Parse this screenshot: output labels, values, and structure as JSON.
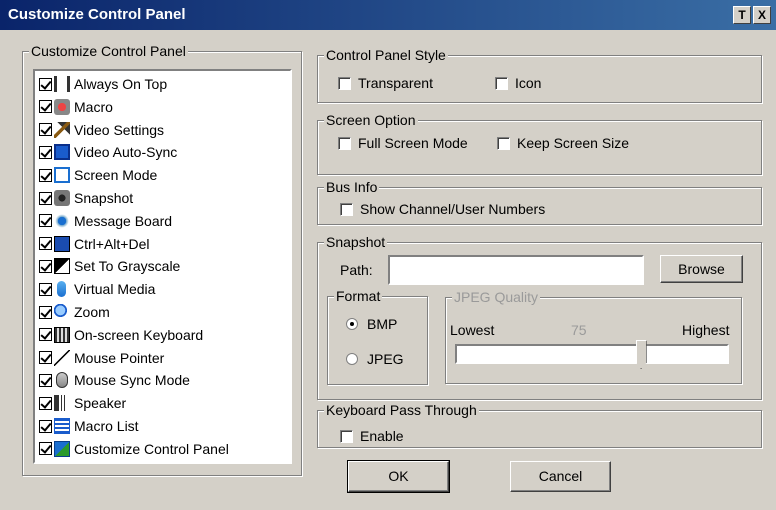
{
  "window": {
    "title": "Customize Control Panel",
    "help_glyph": "T",
    "close_glyph": "X"
  },
  "left_group": {
    "legend": "Customize Control Panel",
    "items": [
      {
        "label": "Always On Top",
        "checked": true,
        "icon": "pin-icon"
      },
      {
        "label": "Macro",
        "checked": true,
        "icon": "macro-icon"
      },
      {
        "label": "Video Settings",
        "checked": true,
        "icon": "video-settings-icon"
      },
      {
        "label": "Video Auto-Sync",
        "checked": true,
        "icon": "video-auto-sync-icon"
      },
      {
        "label": "Screen Mode",
        "checked": true,
        "icon": "screen-mode-icon"
      },
      {
        "label": "Snapshot",
        "checked": true,
        "icon": "camera-icon"
      },
      {
        "label": "Message Board",
        "checked": true,
        "icon": "message-board-icon"
      },
      {
        "label": "Ctrl+Alt+Del",
        "checked": true,
        "icon": "ctrl-alt-del-icon"
      },
      {
        "label": "Set To Grayscale",
        "checked": true,
        "icon": "grayscale-icon"
      },
      {
        "label": "Virtual Media",
        "checked": true,
        "icon": "virtual-media-icon"
      },
      {
        "label": "Zoom",
        "checked": true,
        "icon": "zoom-icon"
      },
      {
        "label": "On-screen Keyboard",
        "checked": true,
        "icon": "keyboard-icon"
      },
      {
        "label": "Mouse Pointer",
        "checked": true,
        "icon": "mouse-pointer-icon"
      },
      {
        "label": "Mouse Sync Mode",
        "checked": true,
        "icon": "mouse-icon"
      },
      {
        "label": "Speaker",
        "checked": true,
        "icon": "speaker-icon"
      },
      {
        "label": "Macro List",
        "checked": true,
        "icon": "macro-list-icon"
      },
      {
        "label": "Customize Control Panel",
        "checked": true,
        "icon": "customize-icon"
      }
    ]
  },
  "style_group": {
    "legend": "Control Panel Style",
    "transparent": "Transparent",
    "icon": "Icon"
  },
  "screen_group": {
    "legend": "Screen Option",
    "full_screen": "Full Screen Mode",
    "keep_size": "Keep Screen Size"
  },
  "bus_group": {
    "legend": "Bus Info",
    "show_numbers": "Show Channel/User Numbers"
  },
  "snapshot_group": {
    "legend": "Snapshot",
    "path_label": "Path:",
    "path_value": "",
    "browse": "Browse",
    "format_legend": "Format",
    "bmp": "BMP",
    "jpeg": "JPEG",
    "selected_format": "BMP",
    "quality_legend": "JPEG Quality",
    "lowest": "Lowest",
    "highest": "Highest",
    "quality_value": "75",
    "quality_fraction": 0.68
  },
  "kbd_group": {
    "legend": "Keyboard Pass Through",
    "enable": "Enable"
  },
  "buttons": {
    "ok": "OK",
    "cancel": "Cancel"
  }
}
